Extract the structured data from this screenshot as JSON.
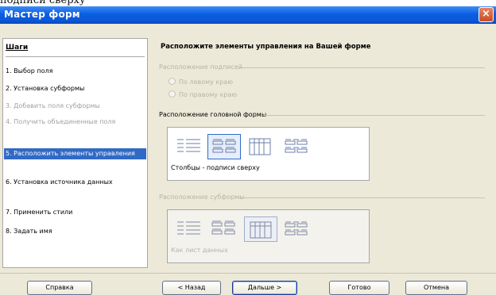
{
  "caption": "подписи сверху",
  "window": {
    "title": "Мастер форм",
    "close_glyph": "×"
  },
  "steps": {
    "title": "Шаги",
    "items": [
      {
        "label": "1. Выбор поля",
        "state": "normal"
      },
      {
        "label": "2. Установка субформы",
        "state": "normal"
      },
      {
        "label": "3. Добавить поля субформы",
        "state": "disabled"
      },
      {
        "label": "4. Получить объединенные поля",
        "state": "disabled"
      },
      {
        "label": "5. Расположить элементы управления",
        "state": "active"
      },
      {
        "label": "6. Установка источника данных",
        "state": "normal"
      },
      {
        "label": "7. Применить стили",
        "state": "normal"
      },
      {
        "label": "8. Задать имя",
        "state": "normal"
      }
    ]
  },
  "main": {
    "heading": "Расположите элементы управления на Вашей форме",
    "label_alignment": {
      "title": "Расположение подписей",
      "options": [
        "По левому краю",
        "По правому краю"
      ]
    },
    "main_form": {
      "title": "Расположение головной формы",
      "selected_caption": "Столбцы - подписи сверху",
      "selected_index": 1
    },
    "subform": {
      "title": "Расположение субформы",
      "selected_caption": "Как лист данных",
      "selected_index": 2
    }
  },
  "buttons": {
    "help": "Справка",
    "back": "< Назад",
    "next": "Дальше >",
    "finish": "Готово",
    "cancel": "Отмена"
  },
  "icons": {
    "close": "close-icon",
    "layouts": [
      "columns-labels-left-icon",
      "columns-labels-top-icon",
      "datasheet-icon",
      "blocks-labels-above-icon"
    ]
  },
  "colors": {
    "title_bar": "#0a5ee3",
    "active_step": "#316ac5",
    "dialog_bg": "#ece9d8"
  }
}
